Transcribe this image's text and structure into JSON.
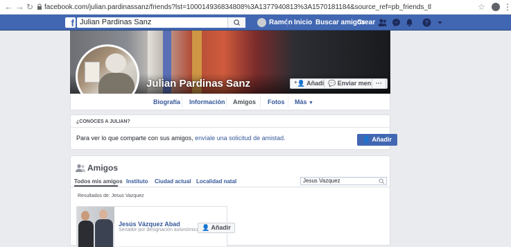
{
  "browser": {
    "url": "facebook.com/julian.pardinassanz/friends?lst=100014936834808%3A1377940813%3A1570181184&source_ref=pb_friends_tl"
  },
  "topbar": {
    "logo": "f",
    "search_value": "Julian Pardinas Sanz",
    "user": "Ramón",
    "home": "Inicio",
    "find_friends": "Buscar amigos",
    "create": "Crear"
  },
  "profile": {
    "name": "Julian Pardinas Sanz",
    "add_button": "Añadir",
    "message_button": "Enviar mensaje",
    "more_button": "···"
  },
  "tabs": {
    "biography": "Biografía",
    "info": "Información",
    "friends": "Amigos",
    "photos": "Fotos",
    "more": "Más"
  },
  "know": {
    "heading": "¿CONOCES A JULIAN?",
    "text": "Para ver lo que comparte con sus amigos,",
    "link": "envíale una solicitud de amistad.",
    "button": "Añadir"
  },
  "friends": {
    "title": "Amigos",
    "tabs": [
      "Todos mis amigos",
      "Instituto",
      "Ciudad actual",
      "Localidad natal"
    ],
    "search_value": "Jesus Vazquez",
    "results_label": "Resultados de: Jesus Vazquez",
    "items": [
      {
        "name": "Jesús Vázquez Abad",
        "subtitle": "Senador por designación autonómica",
        "button": "Añadir"
      }
    ]
  },
  "colors": {
    "brand": "#4267b2",
    "link": "#365899",
    "background": "#e9ebee"
  }
}
